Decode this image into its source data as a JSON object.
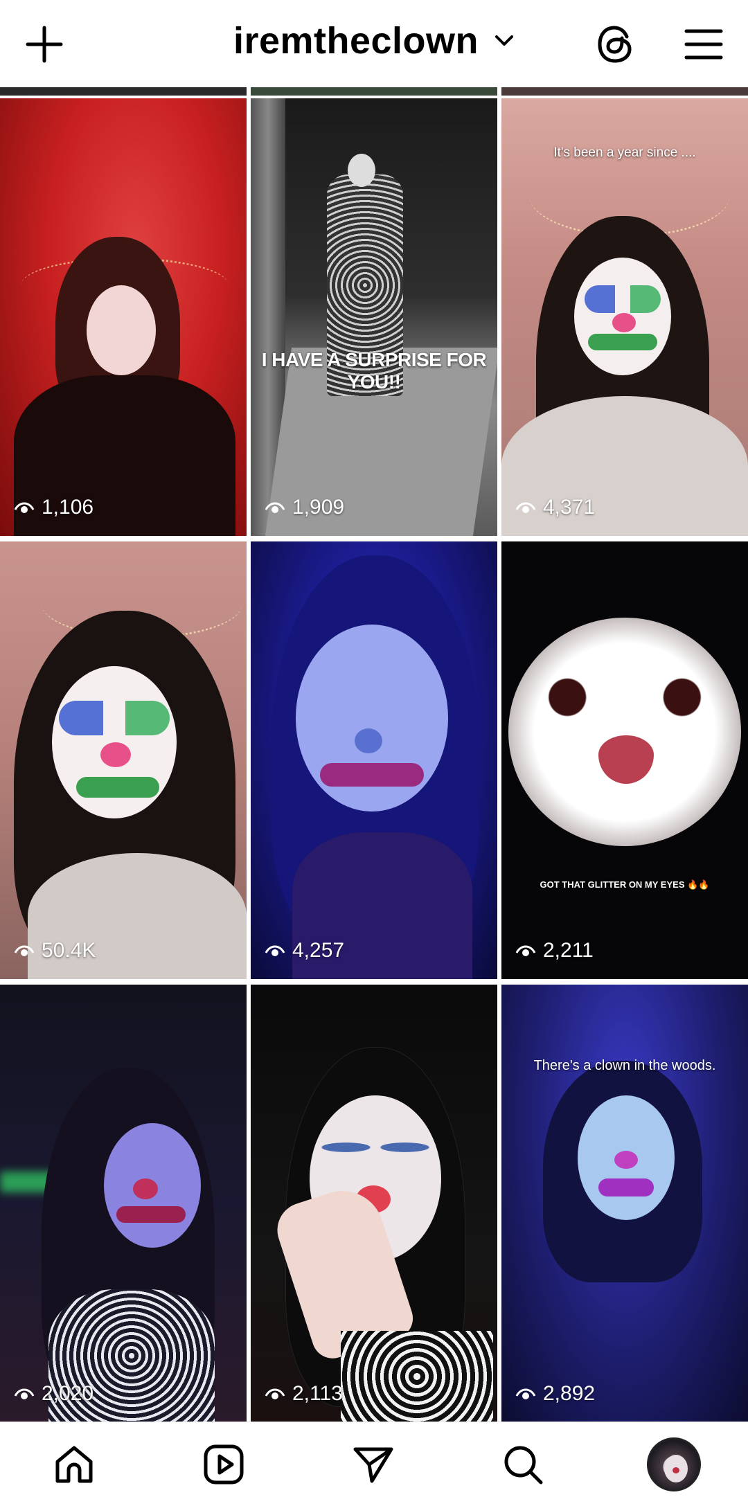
{
  "header": {
    "username": "iremtheclown",
    "icons": [
      "plus-icon",
      "chevron-down-icon",
      "threads-icon",
      "hamburger-menu-icon"
    ]
  },
  "grid": {
    "tiles": [
      {
        "views": "1,106",
        "caption": ""
      },
      {
        "views": "1,909",
        "caption": "I HAVE A SURPRISE FOR YOU!!"
      },
      {
        "views": "4,371",
        "caption": "It's been a year since ...."
      },
      {
        "views": "50.4K",
        "caption": ""
      },
      {
        "views": "4,257",
        "caption": ""
      },
      {
        "views": "2,211",
        "caption": "GOT THAT GLITTER ON MY EYES 🔥🔥"
      },
      {
        "views": "2,020",
        "caption": ""
      },
      {
        "views": "2,113",
        "caption": ""
      },
      {
        "views": "2,892",
        "caption": "There's a clown in the woods."
      }
    ]
  },
  "bottom_nav": {
    "icons": [
      "home-icon",
      "reels-icon",
      "direct-message-icon",
      "search-icon",
      "profile-avatar"
    ]
  },
  "colors": {
    "background": "#ffffff",
    "text": "#000000",
    "overlay_text": "#ffffff"
  }
}
